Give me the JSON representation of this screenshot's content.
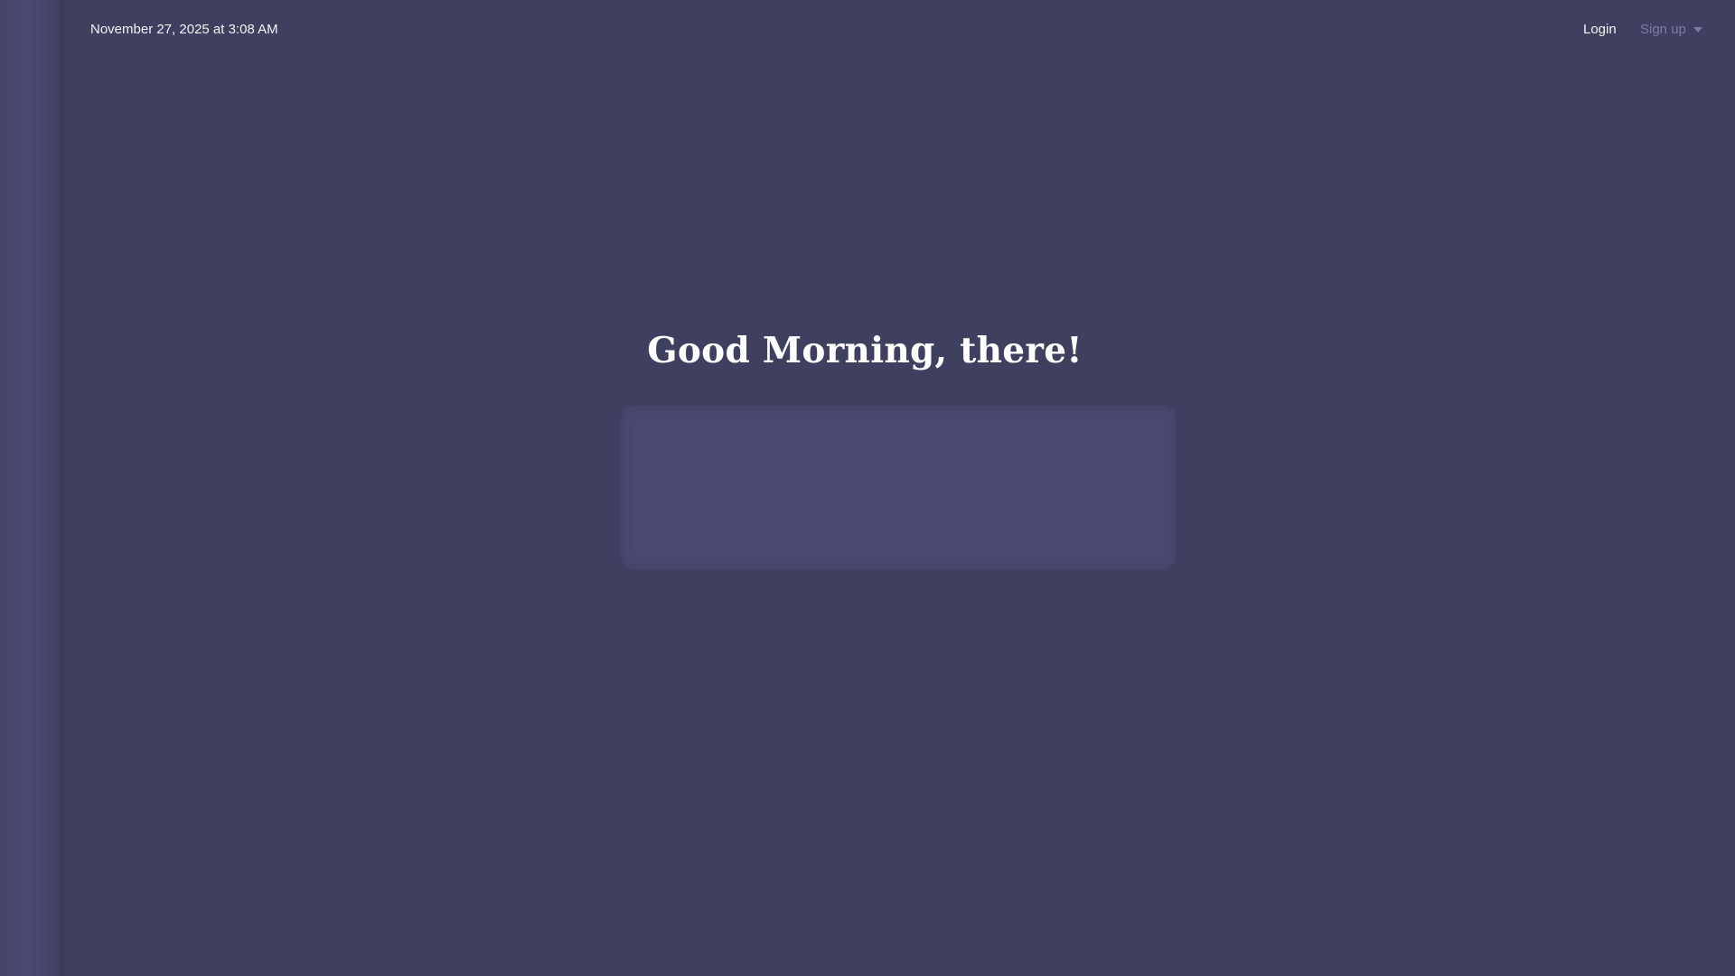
{
  "header": {
    "datetime": "November 27, 2025 at 3:08 AM",
    "login_label": "Login",
    "signup_label": "Sign up"
  },
  "main": {
    "greeting": "Good Morning, there!"
  },
  "icons": {
    "signup_dropdown": "chevron-down-icon"
  },
  "colors": {
    "background": "#3f3f5f",
    "sidebar": "#4a4a70",
    "card": "#4a4a70",
    "text_primary": "#ffffff",
    "text_muted": "#7c7ca1"
  }
}
